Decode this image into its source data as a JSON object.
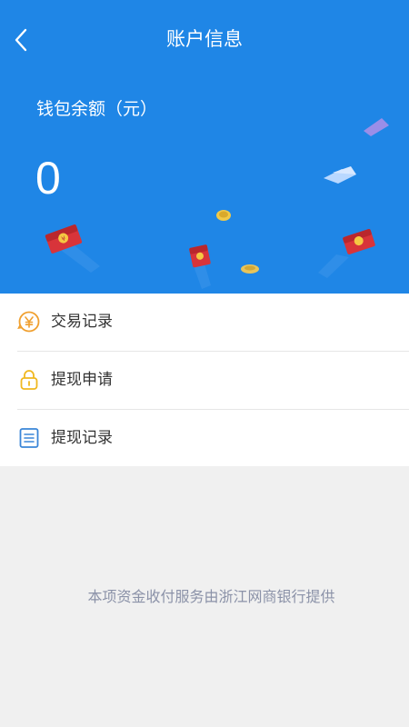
{
  "header": {
    "title": "账户信息",
    "back_icon": "chevron-left-icon",
    "background_color": "#1f86e6"
  },
  "wallet": {
    "label": "钱包余额（元）",
    "balance": "0"
  },
  "menu": {
    "items": [
      {
        "label": "交易记录",
        "icon": "yuan-coin-icon",
        "icon_color": "#f0a030"
      },
      {
        "label": "提现申请",
        "icon": "lock-icon",
        "icon_color": "#f0b820"
      },
      {
        "label": "提现记录",
        "icon": "list-document-icon",
        "icon_color": "#3a86d8"
      }
    ]
  },
  "footer": {
    "note": "本项资金收付服务由浙江网商银行提供"
  }
}
